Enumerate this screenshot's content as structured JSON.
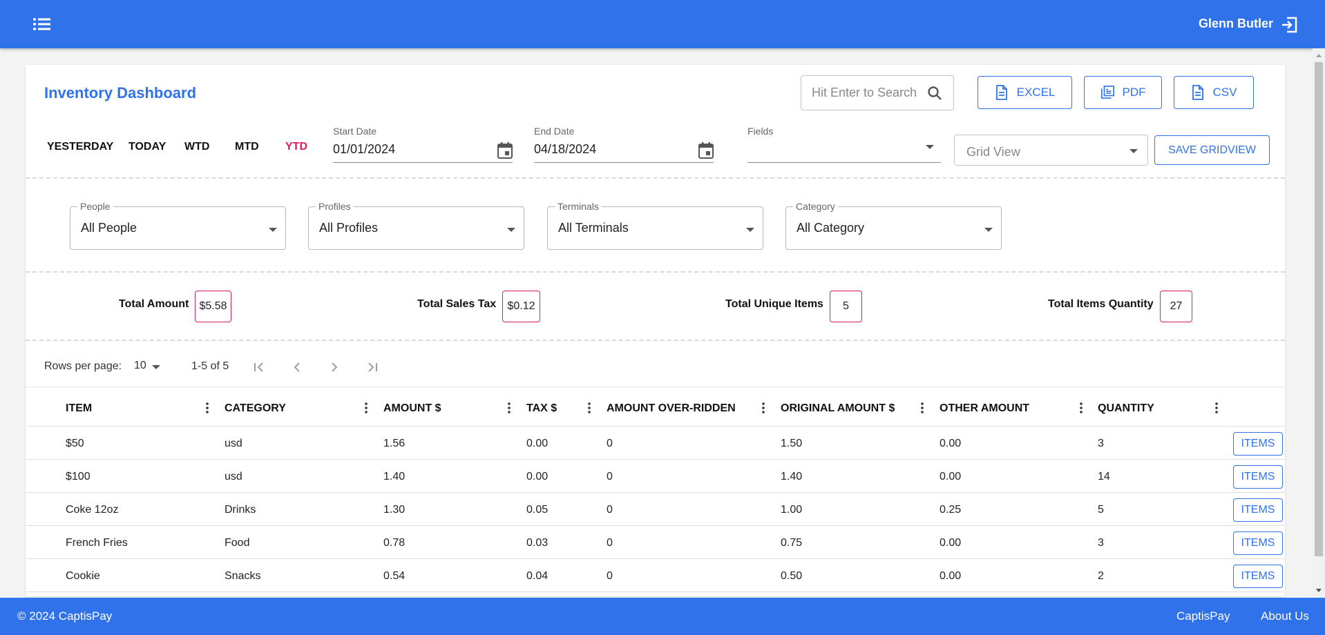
{
  "header": {
    "user_name": "Glenn Butler",
    "menu_icon": "menu-list-icon",
    "logout_icon": "logout-icon"
  },
  "page": {
    "title": "Inventory Dashboard",
    "search_placeholder": "Hit Enter to Search",
    "export_buttons": [
      "EXCEL",
      "PDF",
      "CSV"
    ],
    "quick_ranges": [
      "YESTERDAY",
      "TODAY",
      "WTD",
      "MTD",
      "YTD"
    ],
    "active_range": "YTD",
    "start_date": {
      "label": "Start Date",
      "value": "01/01/2024"
    },
    "end_date": {
      "label": "End Date",
      "value": "04/18/2024"
    },
    "fields": {
      "label": "Fields",
      "value": ""
    },
    "grid_view": {
      "value": "Grid View"
    },
    "save_gridview_label": "SAVE GRIDVIEW"
  },
  "filters": [
    {
      "label": "People",
      "value": "All People"
    },
    {
      "label": "Profiles",
      "value": "All Profiles"
    },
    {
      "label": "Terminals",
      "value": "All Terminals"
    },
    {
      "label": "Category",
      "value": "All Category"
    }
  ],
  "totals": [
    {
      "label": "Total Amount",
      "value": "$5.58"
    },
    {
      "label": "Total Sales Tax",
      "value": "$0.12"
    },
    {
      "label": "Total Unique Items",
      "value": "5"
    },
    {
      "label": "Total Items Quantity",
      "value": "27"
    }
  ],
  "pagination": {
    "rows_per_page_label": "Rows per page:",
    "rows_per_page": "10",
    "range": "1-5 of 5"
  },
  "table": {
    "columns": [
      "ITEM",
      "CATEGORY",
      "AMOUNT $",
      "TAX $",
      "AMOUNT OVER-RIDDEN",
      "ORIGINAL AMOUNT $",
      "OTHER AMOUNT",
      "QUANTITY"
    ],
    "rows": [
      [
        "$50",
        "usd",
        "1.56",
        "0.00",
        "0",
        "1.50",
        "0.00",
        "3"
      ],
      [
        "$100",
        "usd",
        "1.40",
        "0.00",
        "0",
        "1.40",
        "0.00",
        "14"
      ],
      [
        "Coke 12oz",
        "Drinks",
        "1.30",
        "0.05",
        "0",
        "1.00",
        "0.25",
        "5"
      ],
      [
        "French Fries",
        "Food",
        "0.78",
        "0.03",
        "0",
        "0.75",
        "0.00",
        "3"
      ],
      [
        "Cookie",
        "Snacks",
        "0.54",
        "0.04",
        "0",
        "0.50",
        "0.00",
        "2"
      ]
    ],
    "row_action_label": "ITEMS"
  },
  "footer": {
    "copyright": "© 2024 CaptisPay",
    "links": [
      "CaptisPay",
      "About Us"
    ]
  },
  "colors": {
    "primary": "#2f72ea",
    "accent": "#e0195f"
  }
}
